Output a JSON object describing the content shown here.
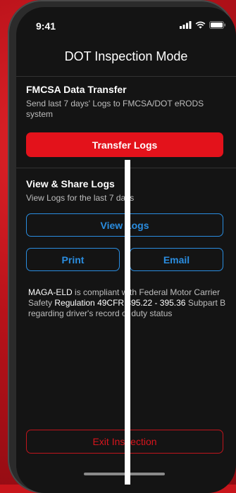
{
  "status_bar": {
    "time": "9:41",
    "icons": [
      "signal-icon",
      "wifi-icon",
      "battery-icon"
    ]
  },
  "header": {
    "title": "DOT Inspection Mode"
  },
  "fmcsa": {
    "title": "FMCSA Data Transfer",
    "description": "Send last 7 days' Logs to FMCSA/DOT eRODS system",
    "transfer_label": "Transfer Logs"
  },
  "view_share": {
    "title": "View & Share Logs",
    "description": "View Logs for the last 7 days",
    "view_label": "View Logs",
    "print_label": "Print",
    "email_label": "Email"
  },
  "compliance": {
    "app_name": "MAGA-ELD",
    "text_1": " is compliant with Federal Motor Carrier Safety ",
    "regulation": "Regulation 49CFR 395.22 - 395.36",
    "text_2": " Subpart B regarding driver's record of duty status"
  },
  "footer": {
    "exit_label": "Exit Inspection"
  },
  "colors": {
    "accent_red": "#e3121b",
    "accent_blue": "#2a8de0",
    "screen_bg": "#141414"
  }
}
